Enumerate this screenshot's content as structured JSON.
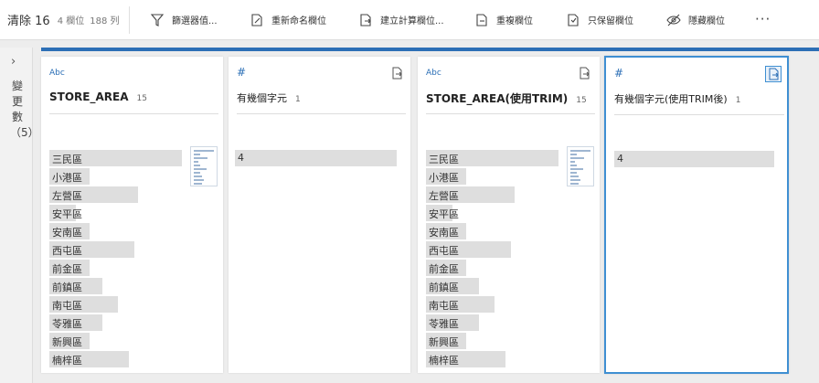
{
  "toolbar": {
    "title": "清除 16",
    "fields": "4 欄位",
    "rows": "188 列",
    "buttons": [
      {
        "label": "篩選器值...",
        "icon": "filter-icon"
      },
      {
        "label": "重新命名欄位",
        "icon": "rename-icon"
      },
      {
        "label": "建立計算欄位...",
        "icon": "calc-field-icon"
      },
      {
        "label": "重複欄位",
        "icon": "duplicate-icon"
      },
      {
        "label": "只保留欄位",
        "icon": "keep-only-icon"
      },
      {
        "label": "隱藏欄位",
        "icon": "hide-icon"
      }
    ],
    "more": "···"
  },
  "sidebar": {
    "chevron": "›",
    "label": "變更數（5）"
  },
  "accent_color": "#2c6fb6",
  "cards": [
    {
      "type": "Abc",
      "name": "STORE_AREA",
      "count": "15",
      "values": [
        "三民區",
        "小港區",
        "左營區",
        "安平區",
        "安南區",
        "西屯區",
        "前金區",
        "前鎮區",
        "南屯區",
        "苓雅區",
        "新興區",
        "楠梓區"
      ],
      "fractions": [
        1.0,
        0.3,
        0.67,
        0.2,
        0.3,
        0.64,
        0.3,
        0.4,
        0.52,
        0.4,
        0.3,
        0.6
      ]
    },
    {
      "type": "#",
      "name": "有幾個字元",
      "count": "1",
      "values": [
        "4"
      ],
      "fractions": [
        1.0
      ]
    },
    {
      "type": "Abc",
      "name": "STORE_AREA(使用TRIM)",
      "count": "15",
      "values": [
        "三民區",
        "小港區",
        "左營區",
        "安平區",
        "安南區",
        "西屯區",
        "前金區",
        "前鎮區",
        "南屯區",
        "苓雅區",
        "新興區",
        "楠梓區"
      ],
      "fractions": [
        1.0,
        0.3,
        0.67,
        0.2,
        0.3,
        0.64,
        0.3,
        0.4,
        0.52,
        0.4,
        0.3,
        0.6
      ]
    },
    {
      "type": "#",
      "name": "有幾個字元(使用TRIM後)",
      "count": "1",
      "values": [
        "4"
      ],
      "fractions": [
        1.0
      ]
    }
  ]
}
